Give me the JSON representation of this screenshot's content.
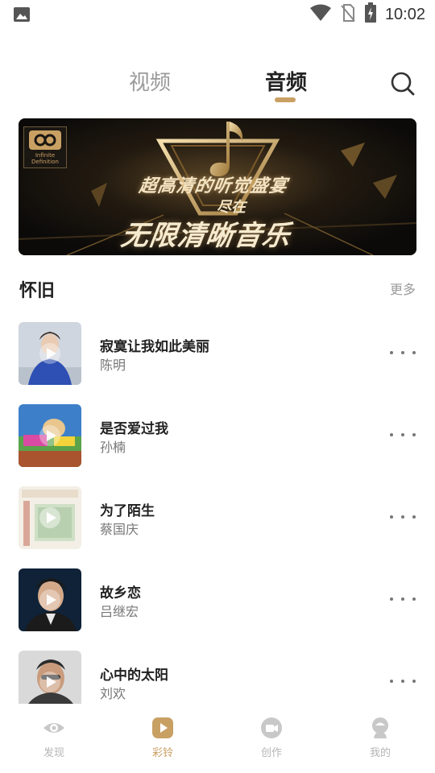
{
  "status_bar": {
    "time": "10:02",
    "icons": [
      "image-icon",
      "wifi-icon",
      "no-sim-icon",
      "battery-charging-icon"
    ]
  },
  "tabs": [
    {
      "label": "视频",
      "active": false
    },
    {
      "label": "音频",
      "active": true
    }
  ],
  "search": {
    "icon": "search-icon"
  },
  "banner": {
    "logo_text": "Infinite Definition",
    "line1": "超高清的听觉盛宴",
    "line2": "尽在",
    "line3": "无限清晰音乐"
  },
  "section": {
    "title": "怀旧",
    "more_label": "更多"
  },
  "songs": [
    {
      "title": "寂寞让我如此美丽",
      "artist": "陈明"
    },
    {
      "title": "是否爱过我",
      "artist": "孙楠"
    },
    {
      "title": "为了陌生",
      "artist": "蔡国庆"
    },
    {
      "title": "故乡恋",
      "artist": "吕继宏"
    },
    {
      "title": "心中的太阳",
      "artist": "刘欢"
    }
  ],
  "bottom_nav": [
    {
      "label": "发现",
      "icon": "eye-icon",
      "active": false
    },
    {
      "label": "彩铃",
      "icon": "play-square-icon",
      "active": true
    },
    {
      "label": "创作",
      "icon": "video-camera-icon",
      "active": false
    },
    {
      "label": "我的",
      "icon": "profile-icon",
      "active": false
    }
  ],
  "colors": {
    "accent": "#c9a063",
    "inactive": "#b5b5b5",
    "text_primary": "#222222",
    "text_secondary": "#777777"
  }
}
